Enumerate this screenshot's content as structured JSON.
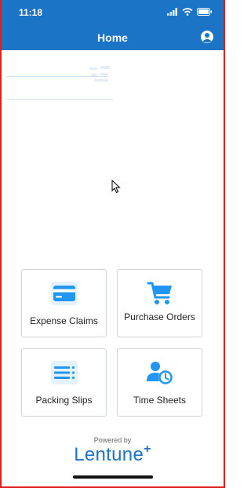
{
  "status_bar": {
    "time": "11:18"
  },
  "header": {
    "title": "Home"
  },
  "tiles": [
    {
      "label": "Expense Claims",
      "icon": "credit-card-icon"
    },
    {
      "label": "Purchase Orders",
      "icon": "shopping-cart-icon"
    },
    {
      "label": "Packing Slips",
      "icon": "list-icon"
    },
    {
      "label": "Time Sheets",
      "icon": "user-clock-icon"
    }
  ],
  "footer": {
    "powered_by": "Powered by",
    "brand": "Lentune",
    "brand_mark": "+"
  },
  "colors": {
    "accent": "#1b74c5",
    "icon_blue": "#2196f3",
    "icon_bg": "#e3f2fd",
    "frame_border": "#e0201c"
  }
}
